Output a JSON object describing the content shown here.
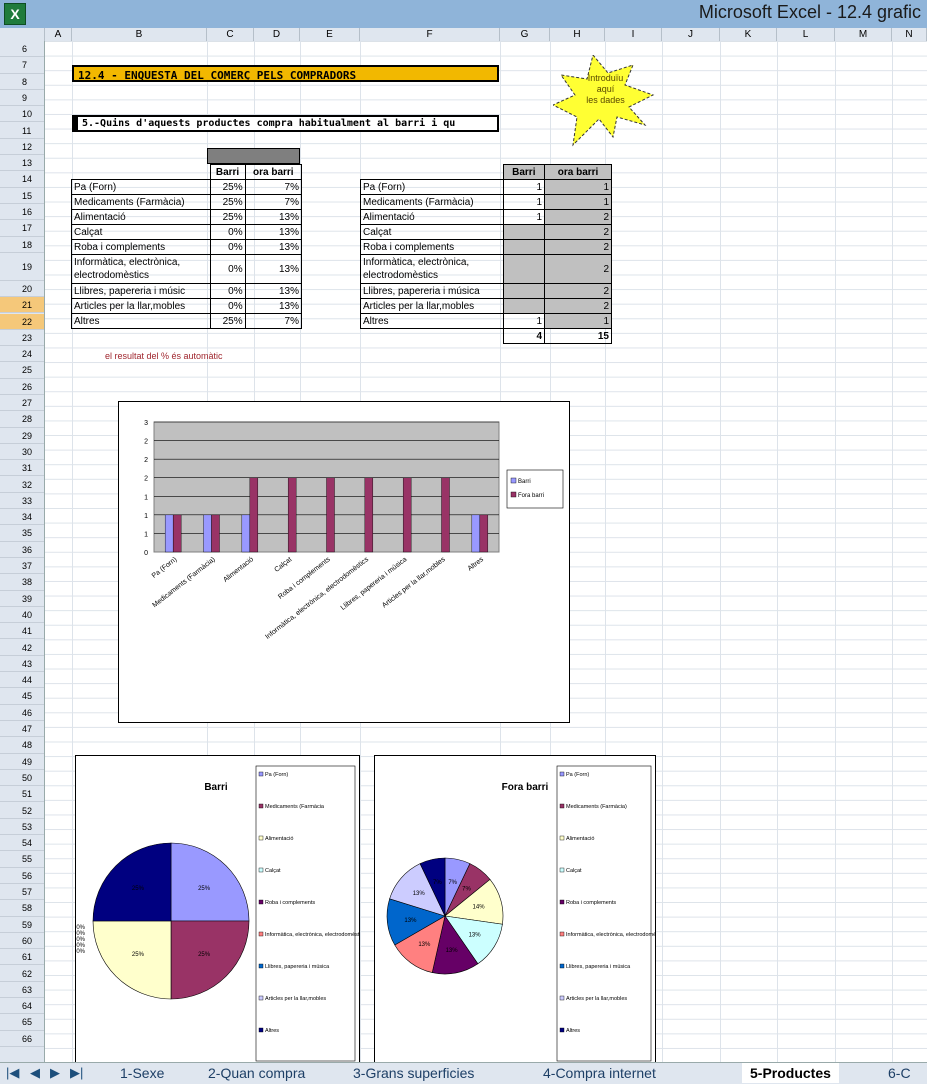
{
  "window": {
    "title": "Microsoft Excel - 12.4 grafic",
    "app_icon": "excel-icon"
  },
  "columns": [
    "A",
    "B",
    "C",
    "D",
    "E",
    "F",
    "G",
    "H",
    "I",
    "J",
    "K",
    "L",
    "M",
    "N"
  ],
  "rows": [
    "6",
    "7",
    "8",
    "9",
    "10",
    "11",
    "12",
    "13",
    "14",
    "15",
    "16",
    "17",
    "18",
    "19",
    "20",
    "21",
    "22",
    "23",
    "24",
    "25",
    "26",
    "27",
    "28",
    "29",
    "30",
    "31",
    "32",
    "33",
    "34",
    "35",
    "36",
    "37",
    "38",
    "39",
    "40",
    "41",
    "42",
    "43",
    "44",
    "45",
    "46",
    "47",
    "48",
    "49",
    "50",
    "51",
    "52",
    "53",
    "54",
    "55",
    "56",
    "57",
    "58",
    "59",
    "60",
    "61",
    "62",
    "63",
    "64",
    "65",
    "66"
  ],
  "selected_rows": [
    "21",
    "22"
  ],
  "title_banner": "12.4 - ENQUESTA DEL COMERÇ PELS COMPRADORS",
  "question_banner": "5.-Quins d'aquests productes compra habitualment al barri i qu",
  "note": {
    "line1": "Introduïu",
    "line2": "aquí",
    "line3": "les dades"
  },
  "pct_table": {
    "headers": [
      "Barri",
      "Fora barri"
    ],
    "header_shown": [
      "Barri",
      "ora barri"
    ],
    "rows": [
      {
        "label": "Pa (Forn)",
        "barri": "25%",
        "fora": "7%"
      },
      {
        "label": "Medicaments (Farmàcia)",
        "barri": "25%",
        "fora": "7%"
      },
      {
        "label": "Alimentació",
        "barri": "25%",
        "fora": "13%"
      },
      {
        "label": "Calçat",
        "barri": "0%",
        "fora": "13%"
      },
      {
        "label": "Roba i complements",
        "barri": "0%",
        "fora": "13%"
      },
      {
        "label": "Informàtica, electrònica, electrodomèstics",
        "barri": "0%",
        "fora": "13%"
      },
      {
        "label": "Llibres, papereria i músic",
        "barri": "0%",
        "fora": "13%"
      },
      {
        "label": "Articles per la llar,mobles",
        "barri": "0%",
        "fora": "13%"
      },
      {
        "label": "Altres",
        "barri": "25%",
        "fora": "7%"
      }
    ],
    "footer_note": "el resultat del % és automàtic"
  },
  "count_table": {
    "header_shown": [
      "Barri",
      "ora barri"
    ],
    "rows": [
      {
        "label": "Pa (Forn)",
        "barri": "1",
        "fora": "1"
      },
      {
        "label": "Medicaments (Farmàcia)",
        "barri": "1",
        "fora": "1"
      },
      {
        "label": "Alimentació",
        "barri": "1",
        "fora": "2"
      },
      {
        "label": "Calçat",
        "barri": "",
        "fora": "2"
      },
      {
        "label": "Roba i complements",
        "barri": "",
        "fora": "2"
      },
      {
        "label": "Informàtica, electrònica, electrodomèstics",
        "barri": "",
        "fora": "2"
      },
      {
        "label": "Llibres, papereria i música",
        "barri": "",
        "fora": "2"
      },
      {
        "label": "Articles per la llar,mobles",
        "barri": "",
        "fora": "2"
      },
      {
        "label": "Altres",
        "barri": "1",
        "fora": "1"
      }
    ],
    "totals": {
      "barri": "4",
      "fora": "15"
    }
  },
  "chart_data": [
    {
      "type": "bar",
      "categories": [
        "Pa (Forn)",
        "Medicaments (Farmàcia)",
        "Alimentació",
        "Calçat",
        "Roba i complements",
        "Informàtica, electrònica, electrodomèstics",
        "Llibres, papereria i música",
        "Articles per la llar,mobles",
        "Altres"
      ],
      "series": [
        {
          "name": "Barri",
          "values": [
            1,
            1,
            1,
            0,
            0,
            0,
            0,
            0,
            1
          ],
          "color": "#9999ff"
        },
        {
          "name": "Fora barri",
          "values": [
            1,
            1,
            2,
            2,
            2,
            2,
            2,
            2,
            1
          ],
          "color": "#993366"
        }
      ],
      "yticks": [
        "0",
        "1",
        "1",
        "1",
        "2",
        "2",
        "2",
        "3"
      ],
      "ylim": [
        0,
        3.5
      ],
      "grid": true,
      "legend": "right",
      "plot_bg": "#c0c0c0"
    },
    {
      "type": "pie",
      "title": "Barri",
      "labels": [
        "Pa (Forn)",
        "Medicaments (Farmàcia)",
        "Alimentació",
        "Calçat",
        "Roba i complements",
        "Informàtica, electrònica, electrodomèstics",
        "Llibres, papereria i música",
        "Articles per la llar,mobles",
        "Altres"
      ],
      "legend_labels": [
        "Pa (Forn)",
        "Medicaments (Farmàcia",
        "Alimentació",
        "Calçat",
        "Roba i complements",
        "Informàtica, electrònica, electrodomèstics",
        "Llibres, papereria i música",
        "Articles per la llar,mobles",
        "Altres"
      ],
      "values": [
        25,
        25,
        25,
        0,
        0,
        0,
        0,
        0,
        25
      ],
      "data_labels": [
        "25%",
        "25%",
        "25%",
        "0%",
        "0%",
        "0%",
        "0%",
        "0%",
        "25%"
      ],
      "colors": [
        "#9999ff",
        "#993366",
        "#ffffcc",
        "#ccffff",
        "#660066",
        "#ff8080",
        "#0066cc",
        "#ccccff",
        "#000080"
      ]
    },
    {
      "type": "pie",
      "title": "Fora barri",
      "labels": [
        "Pa (Forn)",
        "Medicaments (Farmàcia)",
        "Alimentació",
        "Calçat",
        "Roba i complements",
        "Informàtica, electrònica, electrodomèstics",
        "Llibres, papereria i música",
        "Articles per la llar,mobles",
        "Altres"
      ],
      "legend_labels": [
        "Pa (Forn)",
        "Medicaments (Farmàcia)",
        "Alimentació",
        "Calçat",
        "Roba i complements",
        "Informàtica, electrònica, electrodomèstics",
        "Llibres, papereria i música",
        "Articles per la llar,mobles",
        "Altres"
      ],
      "values": [
        7,
        7,
        13,
        13,
        13,
        13,
        13,
        13,
        7
      ],
      "data_labels": [
        "7%",
        "7%",
        "14%",
        "13%",
        "13%",
        "13%",
        "13%",
        "13%",
        "7%"
      ],
      "colors": [
        "#9999ff",
        "#993366",
        "#ffffcc",
        "#ccffff",
        "#660066",
        "#ff8080",
        "#0066cc",
        "#ccccff",
        "#000080"
      ]
    }
  ],
  "sheet_tabs": [
    "1-Sexe",
    "2-Quan compra",
    "3-Grans superficies",
    "4-Compra internet",
    "5-Productes",
    "6-C"
  ],
  "active_tab": "5-Productes",
  "nav_icons": [
    "first-sheet-icon",
    "prev-sheet-icon",
    "next-sheet-icon",
    "last-sheet-icon"
  ]
}
